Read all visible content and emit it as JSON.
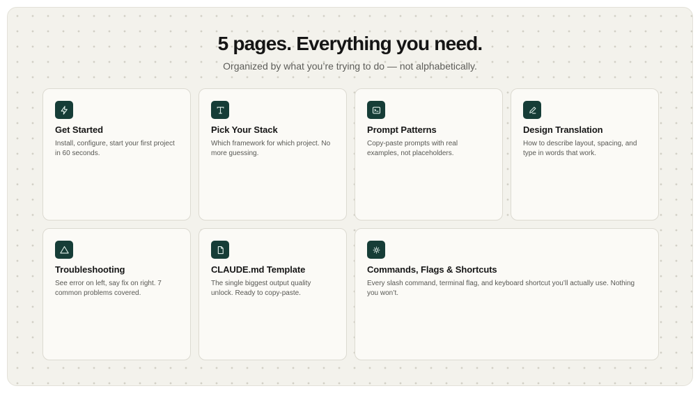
{
  "header": {
    "title": "5 pages. Everything you need.",
    "subtitle": "Organized by what you’re trying to do — not alphabetically."
  },
  "cards": [
    {
      "title": "Get Started",
      "description": "Install, configure, start your first project in 60 seconds.",
      "icon": "lightning-bolt-icon"
    },
    {
      "title": "Pick Your Stack",
      "description": "Which framework for which project. No more guessing.",
      "icon": "type-icon"
    },
    {
      "title": "Prompt Patterns",
      "description": "Copy-paste prompts with real examples, not placeholders.",
      "icon": "terminal-icon"
    },
    {
      "title": "Design Translation",
      "description": "How to describe layout, spacing, and type in words that work.",
      "icon": "pen-icon"
    },
    {
      "title": "Troubleshooting",
      "description": "See error on left, say fix on right. 7 common problems covered.",
      "icon": "warning-triangle-icon"
    },
    {
      "title": "CLAUDE.md Template",
      "description": "The single biggest output quality unlock. Ready to copy-paste.",
      "icon": "file-icon"
    },
    {
      "title": "Commands, Flags & Shortcuts",
      "description": "Every slash command, terminal flag, and keyboard shortcut you’ll actually use. Nothing you won’t.",
      "icon": "sun-icon"
    }
  ],
  "colors": {
    "background": "#f3f2ec",
    "card": "#fbfaf6",
    "icon_badge": "#163d37",
    "icon_stroke": "#dfeee9",
    "title": "#161616",
    "body": "#585854"
  }
}
